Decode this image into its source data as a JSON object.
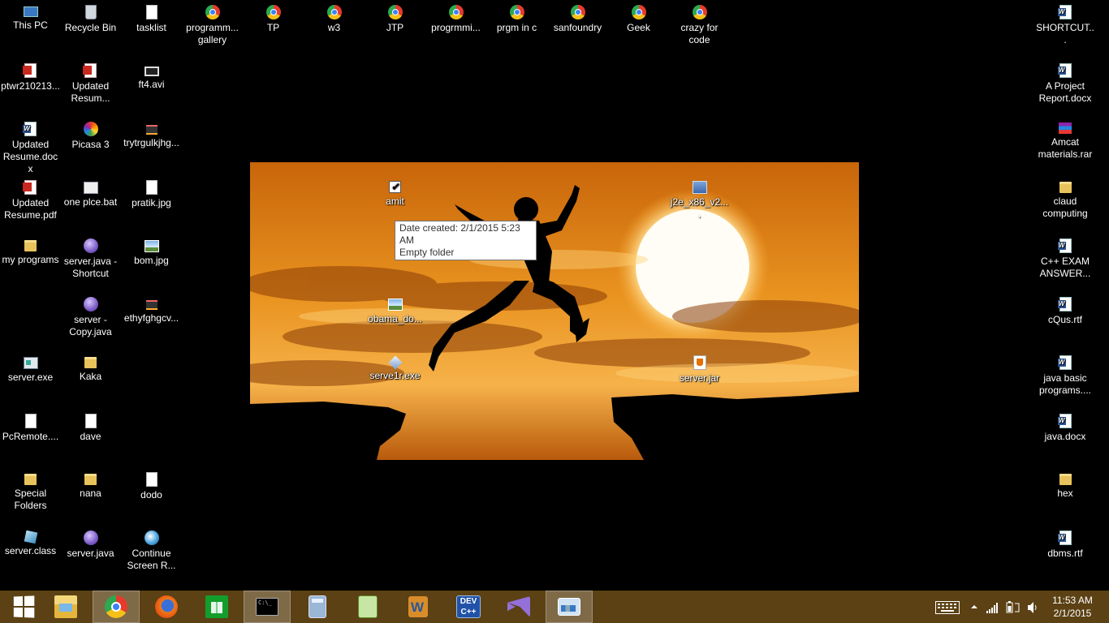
{
  "desktop": {
    "icons_left": [
      {
        "label": "This PC",
        "icon": "pc-icon"
      },
      {
        "label": "Recycle Bin",
        "icon": "recycle-bin-icon"
      },
      {
        "label": "tasklist",
        "icon": "file-icon"
      },
      {
        "label": "programm... gallery",
        "icon": "chrome-shortcut-icon"
      },
      {
        "label": "TP",
        "icon": "chrome-shortcut-icon"
      },
      {
        "label": "w3",
        "icon": "chrome-shortcut-icon"
      },
      {
        "label": "JTP",
        "icon": "chrome-shortcut-icon"
      },
      {
        "label": "progrmmi...",
        "icon": "chrome-shortcut-icon"
      },
      {
        "label": "prgm in c",
        "icon": "chrome-shortcut-icon"
      },
      {
        "label": "sanfoundry",
        "icon": "chrome-shortcut-icon"
      },
      {
        "label": "Geek",
        "icon": "chrome-shortcut-icon"
      },
      {
        "label": "crazy for code",
        "icon": "chrome-shortcut-icon"
      },
      {
        "label": "ptwr210213...",
        "icon": "pdf-icon"
      },
      {
        "label": "Updated Resum...",
        "icon": "pdf-icon"
      },
      {
        "label": "ft4.avi",
        "icon": "video-icon"
      },
      {
        "label": "Updated Resume.docx",
        "icon": "word-doc-icon"
      },
      {
        "label": "Picasa 3",
        "icon": "picasa-icon"
      },
      {
        "label": "trytrgulkjhg...",
        "icon": "dll-icon"
      },
      {
        "label": "Updated Resume.pdf",
        "icon": "pdf-icon"
      },
      {
        "label": "one plce.bat",
        "icon": "bat-icon"
      },
      {
        "label": "pratik.jpg",
        "icon": "file-icon"
      },
      {
        "label": "my programs",
        "icon": "folder-icon"
      },
      {
        "label": "server.java - Shortcut",
        "icon": "java-icon"
      },
      {
        "label": "bom.jpg",
        "icon": "image-icon"
      },
      {
        "label": "server - Copy.java",
        "icon": "java-icon"
      },
      {
        "label": "ethyfghgcv...",
        "icon": "dll-icon"
      },
      {
        "label": "server.exe",
        "icon": "exe-icon"
      },
      {
        "label": "Kaka",
        "icon": "folder-icon"
      },
      {
        "label": "PcRemote....",
        "icon": "file-icon"
      },
      {
        "label": "dave",
        "icon": "file-icon"
      },
      {
        "label": "Special Folders",
        "icon": "folder-icon"
      },
      {
        "label": "nana",
        "icon": "folder-icon"
      },
      {
        "label": "dodo",
        "icon": "file-icon"
      },
      {
        "label": "server.class",
        "icon": "class-icon"
      },
      {
        "label": "server.java",
        "icon": "java-icon"
      },
      {
        "label": "Continue Screen R...",
        "icon": "continue-icon"
      }
    ],
    "icons_center": [
      {
        "label": "amit",
        "icon": "checkbox-folder-icon"
      },
      {
        "label": "j2e_x86_v2....",
        "icon": "setup-icon"
      },
      {
        "label": "obama_do...",
        "icon": "image-icon"
      },
      {
        "label": "serve1r.exe",
        "icon": "crystal-icon"
      },
      {
        "label": "server.jar",
        "icon": "jar-icon"
      }
    ],
    "icons_right": [
      {
        "label": "SHORTCUT...",
        "icon": "word-doc-icon"
      },
      {
        "label": "A Project Report.docx",
        "icon": "word-doc-icon"
      },
      {
        "label": "Amcat materials.rar",
        "icon": "rar-icon"
      },
      {
        "label": "claud computing",
        "icon": "folder-icon"
      },
      {
        "label": "C++ EXAM ANSWER...",
        "icon": "word-doc-icon"
      },
      {
        "label": "cQus.rtf",
        "icon": "word-doc-icon"
      },
      {
        "label": "java basic programs....",
        "icon": "word-doc-icon"
      },
      {
        "label": "java.docx",
        "icon": "word-doc-icon"
      },
      {
        "label": "hex",
        "icon": "folder-icon"
      },
      {
        "label": "dbms.rtf",
        "icon": "word-doc-icon"
      }
    ],
    "tooltip": {
      "line1": "Date created: 2/1/2015 5:23 AM",
      "line2": "Empty folder"
    }
  },
  "taskbar": {
    "apps": [
      {
        "name": "start-button"
      },
      {
        "name": "file-explorer"
      },
      {
        "name": "google-chrome"
      },
      {
        "name": "firefox"
      },
      {
        "name": "store"
      },
      {
        "name": "command-prompt"
      },
      {
        "name": "calculator"
      },
      {
        "name": "notepad-plus-plus"
      },
      {
        "name": "microsoft-word"
      },
      {
        "name": "dev-cpp"
      },
      {
        "name": "visual-studio"
      },
      {
        "name": "remote-monitor"
      }
    ],
    "dev_label": "DEV C++",
    "clock": {
      "time": "11:53 AM",
      "date": "2/1/2015"
    },
    "colors": {
      "taskbar": "#5b4114",
      "accent": "#ffffff"
    }
  }
}
